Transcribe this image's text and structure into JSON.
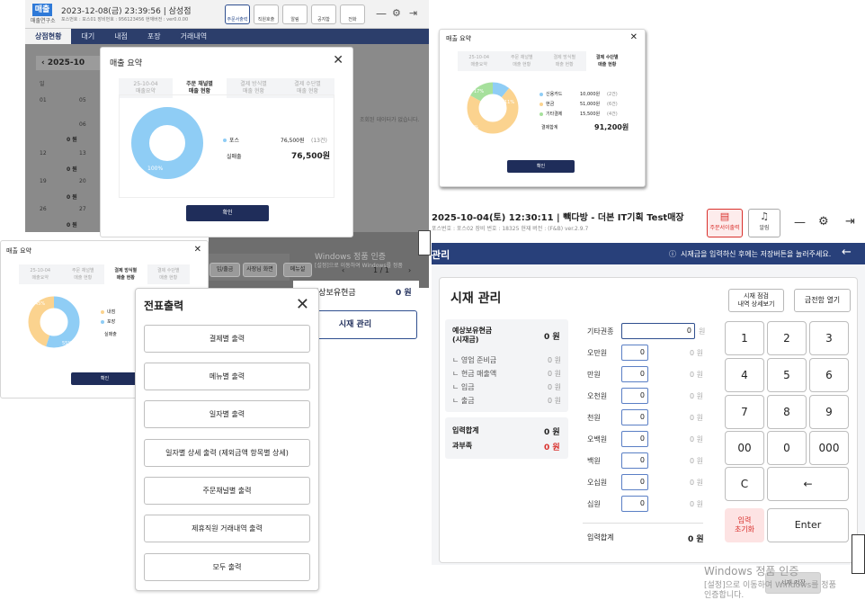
{
  "bg_app": {
    "logo": "매출",
    "logo_sub": "매출연구소",
    "datetime": "2023-12-08(금) 23:39:56",
    "store": "삼성점",
    "meta": "포스번호 : 포스01  장비번호 : 956123456  현재버전 : ver0.0.00",
    "top_buttons": [
      "주문서출력",
      "직원호출",
      "알림",
      "공지함",
      "전화"
    ],
    "nav_tabs": [
      "상점현황",
      "대기",
      "내점",
      "포장",
      "거래내역"
    ],
    "month": "2025-10",
    "weekday_head": [
      "일"
    ],
    "days": [
      "01",
      "05",
      "06",
      "12",
      "13",
      "19",
      "20",
      "26",
      "27"
    ],
    "day_zero": "0 원",
    "no_data": "조회된 데이터가 없습니다.",
    "bottom_buttons": [
      "입/출금",
      "사장님 화면",
      "메뉴설"
    ],
    "paging": "1 / 1",
    "cash_label": "예상보유현금",
    "cash_value": "0 원",
    "cash_btn": "시재 관리",
    "windows_wm_1": "Windows 정품 인증",
    "windows_wm_2": "[설정]으로 이동하여 Windows를 정품",
    "windows_wm_3": "인증합니다."
  },
  "modal_main": {
    "title": "매출 요약",
    "tabs": [
      "25-10-04\n매출요약",
      "주문 채널별\n매출 현황",
      "결제 방식별\n매출 현황",
      "결제 수단별\n매출 현황"
    ],
    "active_tab": 1,
    "legend": [
      {
        "name": "포스",
        "value": "76,500원",
        "count": "(13건)"
      }
    ],
    "total_label": "실매출",
    "total_value": "76,500원",
    "pie_pct": "100%",
    "ok": "확인"
  },
  "modal_payment": {
    "title": "매출 요약",
    "tabs": [
      "25-10-04\n매출요약",
      "주문 채널별\n매출 현황",
      "결제 방식별\n매출 현황",
      "결제 수단별\n매출 현황"
    ],
    "active_tab": 3,
    "legend": [
      {
        "name": "신용카드",
        "value": "10,000원",
        "count": "(2건)",
        "color": "#8fcdf5"
      },
      {
        "name": "현금",
        "value": "51,000원",
        "count": "(6건)",
        "color": "#fbd38f"
      },
      {
        "name": "기타결제",
        "value": "15,500원",
        "count": "(4건)",
        "color": "#a6e09c"
      }
    ],
    "pct_labels": [
      "17%",
      "11%",
      "55%"
    ],
    "total_label": "결제합계",
    "total_value": "91,200원",
    "ok": "확인"
  },
  "modal_method": {
    "title": "매출 요약",
    "tabs": [
      "25-10-04\n매출요약",
      "주문 채널별\n매출 현황",
      "결제 방식별\n매출 현황",
      "결제 수단별\n매출 현황"
    ],
    "active_tab": 2,
    "legend": [
      {
        "name": "내점",
        "color": "#fbd38f"
      },
      {
        "name": "포장",
        "color": "#8fcdf5"
      }
    ],
    "pct_labels": [
      "45%",
      "55%"
    ],
    "total_label": "실매출",
    "ok": "확인"
  },
  "slip_modal": {
    "title": "전표출력",
    "buttons": [
      "결제별 출력",
      "메뉴별 출력",
      "일자별 출력",
      "일자별 상세 출력 (제외금액 항목별 상세)",
      "주문채널별 출력",
      "제휴직원 거래내역 출력",
      "모두 출력"
    ]
  },
  "right_app": {
    "datetime": "2025-10-04(토) 12:30:11",
    "store": "빽다방 - 더본 IT기획 Test매장",
    "meta": "포스번호 : 포스02  장비 번호 : 18325  현재 버전 : (F&B) ver.2.9.7",
    "print_btn": "주문서이출력",
    "alarm_btn": "알림",
    "bar_title": "관리",
    "bar_notice": "시재금을 입력하신 후에는 저장버튼을 눌러주세요.",
    "page_title": "시재 관리",
    "history_btn": "시재 점검\n내역 상세보기",
    "drawer_btn": "금전함 열기",
    "expected_label": "예상보유현금\n(시재금)",
    "expected_value": "0 원",
    "sub_items": [
      {
        "label": "ㄴ 영업 준비금",
        "value": "0 원"
      },
      {
        "label": "ㄴ 현금 매출액",
        "value": "0 원"
      },
      {
        "label": "ㄴ 입금",
        "value": "0 원"
      },
      {
        "label": "ㄴ 출금",
        "value": "0 원"
      }
    ],
    "input_total_label": "입력합계",
    "input_total_value": "0 원",
    "over_label": "과부족",
    "over_value": "0 원",
    "denoms": [
      {
        "label": "기타권종",
        "value": "0",
        "won": "원"
      },
      {
        "label": "오만원",
        "value": "0",
        "won": "0 원"
      },
      {
        "label": "만원",
        "value": "0",
        "won": "0 원"
      },
      {
        "label": "오천원",
        "value": "0",
        "won": "0 원"
      },
      {
        "label": "천원",
        "value": "0",
        "won": "0 원"
      },
      {
        "label": "오백원",
        "value": "0",
        "won": "0 원"
      },
      {
        "label": "백원",
        "value": "0",
        "won": "0 원"
      },
      {
        "label": "오십원",
        "value": "0",
        "won": "0 원"
      },
      {
        "label": "십원",
        "value": "0",
        "won": "0 원"
      }
    ],
    "denom_total_label": "입력합계",
    "denom_total_value": "0 원",
    "keypad": [
      "1",
      "2",
      "3",
      "4",
      "5",
      "6",
      "7",
      "8",
      "9",
      "00",
      "0",
      "000",
      "C",
      "←"
    ],
    "reset_btn": "입력\n초기화",
    "enter_btn": "Enter",
    "save_btn": "시재 저장",
    "windows_wm_1": "Windows 정품 인증",
    "windows_wm_2": "[설정]으로 이동하여 Windows를 정품",
    "windows_wm_3": "인증합니다."
  },
  "colors": {
    "navy": "#28407a",
    "pie_blue": "#8fcdf5",
    "pie_yellow": "#fbd38f",
    "pie_green": "#a6e09c",
    "red": "#d9302c"
  }
}
